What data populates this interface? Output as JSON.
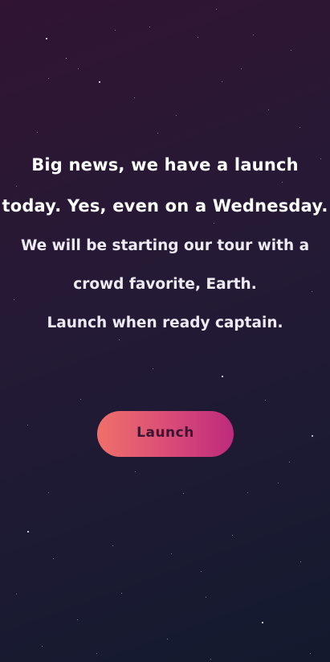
{
  "hero": {
    "headline_line1": "Big news, we have a launch",
    "headline_line2": "today. Yes, even on a Wednesday.",
    "body_line1": "We will be starting our tour with a",
    "body_line2": "crowd favorite, Earth.",
    "body_line3": "Launch when ready captain."
  },
  "cta": {
    "launch_label": "Launch"
  },
  "theme": {
    "background_top": "#311434",
    "background_bottom": "#131a2e",
    "button_gradient_start": "#f0706a",
    "button_gradient_end": "#bd2a7c",
    "button_text": "#3a1430",
    "text": "#ffffff"
  }
}
